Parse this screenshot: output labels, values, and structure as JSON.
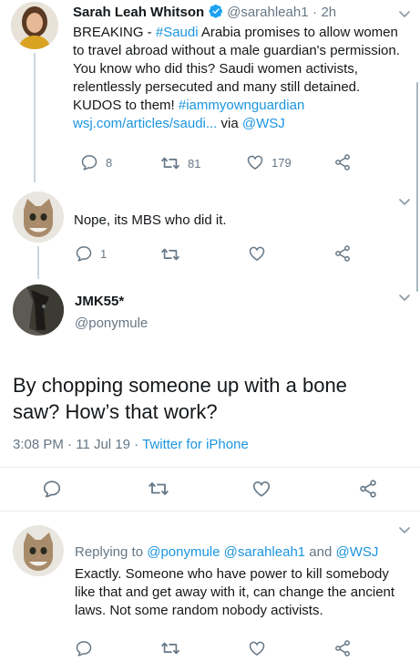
{
  "tweet1": {
    "name": "Sarah Leah Whitson",
    "handle": "@sarahleah1",
    "sep": "·",
    "time": "2h",
    "text_parts": {
      "p1": "BREAKING - ",
      "hashtag1": "#Saudi",
      "p2": " Arabia promises to allow women to travel abroad without a male guardian's permission. You know who did this? Saudi women activists, relentlessly persecuted and many still detained. KUDOS to them! ",
      "hashtag2": "#iammyownguardian",
      "link": "wsj.com/articles/saudi...",
      "p3": " via ",
      "mention": "@WSJ"
    },
    "replies": "8",
    "retweets": "81",
    "likes": "179"
  },
  "tweet2": {
    "text": "Nope, its MBS who did it.",
    "replies": "1"
  },
  "main_tweet": {
    "name": "JMK55*",
    "handle": "@ponymule",
    "text": "By chopping someone up with a bone saw? How’s that work?",
    "time": "3:08 PM",
    "sep1": "·",
    "date": "11 Jul 19",
    "sep2": "·",
    "source": "Twitter for iPhone"
  },
  "reply": {
    "replying_prefix": "Replying to ",
    "replying_1": "@ponymule",
    "replying_2": "@sarahleah1",
    "replying_and": " and ",
    "replying_3": "@WSJ",
    "text": "Exactly. Someone who have power to kill somebody like that and get away with it, can change the ancient laws. Not some random nobody activists."
  },
  "colors": {
    "accent": "#1b95e0",
    "muted": "#657786",
    "verified": "#1da1f2"
  },
  "icons": [
    "reply-icon",
    "retweet-icon",
    "like-icon",
    "share-icon",
    "caret-down-icon",
    "verified-badge-icon"
  ]
}
